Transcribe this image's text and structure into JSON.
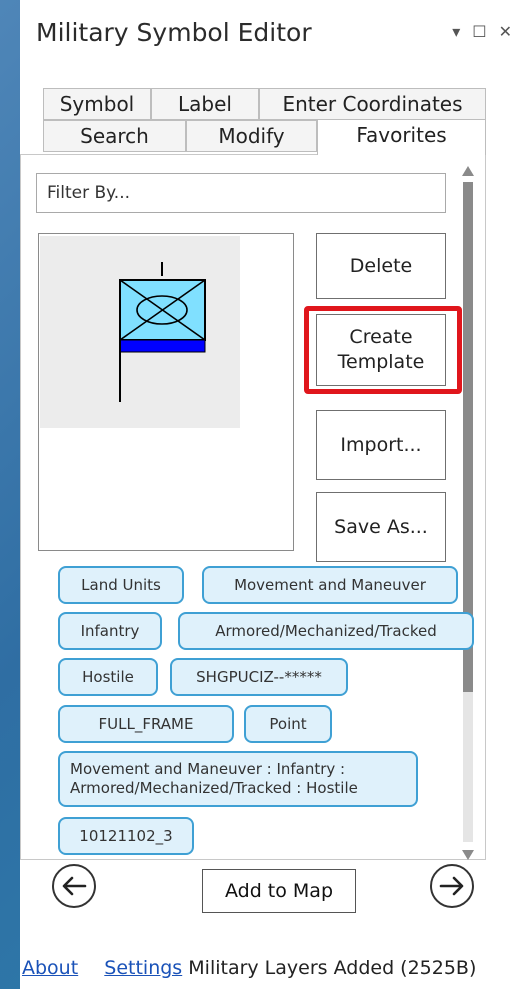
{
  "window": {
    "title": "Military Symbol Editor",
    "controls": {
      "dropdown": "▾",
      "maximize": "☐",
      "close": "✕"
    }
  },
  "tabs": {
    "row1": [
      "Symbol",
      "Label",
      "Enter Coordinates"
    ],
    "row2": [
      "Search",
      "Modify",
      "Favorites"
    ],
    "active": "Favorites"
  },
  "filter": {
    "placeholder": "Filter By..."
  },
  "actions": {
    "delete": "Delete",
    "create_template": "Create Template",
    "import": "Import...",
    "save_as": "Save As..."
  },
  "tags": [
    "Land Units",
    "Movement and Maneuver",
    "Infantry",
    "Armored/Mechanized/Tracked",
    "Hostile",
    "SHGPUCIZ--*****",
    "FULL_FRAME",
    "Point",
    "Movement and Maneuver : Infantry : Armored/Mechanized/Tracked : Hostile",
    "10121102_3"
  ],
  "bottom": {
    "add_to_map": "Add to Map"
  },
  "footer": {
    "about": "About",
    "settings": "Settings",
    "status": "Military Layers Added (2525B)"
  },
  "colors": {
    "highlight": "#e0161c",
    "tag_border": "#3fa0d4",
    "tag_fill": "#dff1fb",
    "symbol_fill": "#80e0ff",
    "symbol_bar": "#0000ff",
    "link": "#1a52b8"
  },
  "icons": {
    "symbol": "military-unit-symbol-icon",
    "back": "arrow-left-icon",
    "forward": "arrow-right-icon"
  }
}
